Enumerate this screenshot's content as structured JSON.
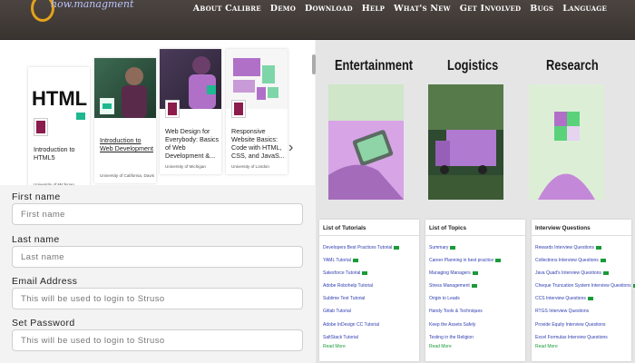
{
  "brand": {
    "logo_text": "how.managment"
  },
  "nav": [
    "About Calibre",
    "Demo",
    "Download",
    "Help",
    "What's New",
    "Get Involved",
    "Bugs",
    "Language"
  ],
  "courses": [
    {
      "title": "Introduction to HTML5",
      "university": "University of Michigan",
      "thumb_text": "HTML",
      "underlined": false
    },
    {
      "title": "Introduction to Web Development",
      "university": "University of California, Davis",
      "thumb_text": "",
      "underlined": true
    },
    {
      "title": "Web Design for Everybody: Basics of Web Development &...",
      "university": "University of Michigan",
      "thumb_text": "",
      "underlined": false
    },
    {
      "title": "Responsive Website Basics: Code with HTML, CSS, and JavaS...",
      "university": "University of London",
      "thumb_text": "",
      "underlined": false
    }
  ],
  "carousel_next": "›",
  "form": {
    "first_name": {
      "label": "First name",
      "placeholder": "First name"
    },
    "last_name": {
      "label": "Last name",
      "placeholder": "Last name"
    },
    "email": {
      "label": "Email Address",
      "placeholder": "This will be used to login to Struso"
    },
    "password": {
      "label": "Set Password",
      "placeholder": "This will be used to login to Struso"
    }
  },
  "segments": [
    "Entertainment",
    "Logistics",
    "Research"
  ],
  "lists": [
    {
      "title": "List of Tutorials",
      "items": [
        "Developers Best Practices Tutorial",
        "YAML Tutorial",
        "Salesforce Tutorial",
        "Adobe Robohelp Tutorial",
        "Sublime Text Tutorial",
        "Gitlab Tutorial",
        "Adobe InDesign CC Tutorial",
        "SaltStack Tutorial"
      ],
      "read_more": "Read More"
    },
    {
      "title": "List of Topics",
      "items": [
        "Summary",
        "Career Planning in best practice",
        "Managing Managers",
        "Stress Management",
        "Origin to Leads",
        "Handy Tools & Techniques",
        "Keep the Assets Safely",
        "Testing in the Religion"
      ],
      "read_more": "Read More"
    },
    {
      "title": "Interview Questions",
      "items": [
        "Rewards Interview Questions",
        "Collections Interview Questions",
        "Java Quad's Interview Questions",
        "Cheque Truncation System Interview Questions",
        "CCS Interview Questions",
        "RTGS Interview Questions",
        "Provide Equity Interview Questions",
        "Excel Formulas Interview Questions"
      ],
      "read_more": "Read More"
    }
  ],
  "colors": {
    "nav_bg": "#3f3834",
    "logo_accent": "#e3a21a",
    "link_blue": "#2f3db0",
    "tag_green": "#1a9b38",
    "thumb_tint": "#c27ad6"
  }
}
